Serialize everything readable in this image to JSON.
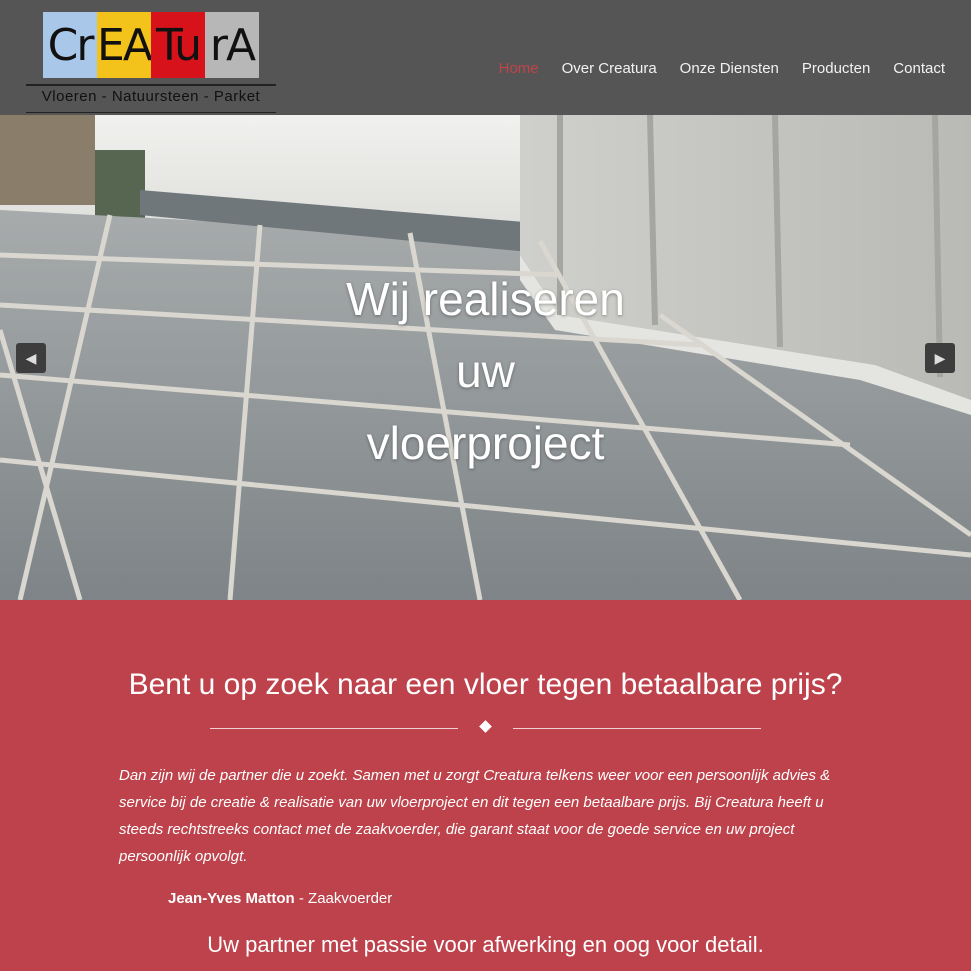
{
  "brand": {
    "logo_letters": [
      "Cr",
      "EA",
      "Tu",
      "rA"
    ],
    "logo_colors": [
      "#a9c7e8",
      "#f3c21b",
      "#d8121b",
      "#b7b7b7"
    ],
    "tagline": "Vloeren - Natuursteen - Parket"
  },
  "nav": {
    "items": [
      {
        "label": "Home",
        "active": true
      },
      {
        "label": "Over Creatura",
        "active": false
      },
      {
        "label": "Onze Diensten",
        "active": false
      },
      {
        "label": "Producten",
        "active": false
      },
      {
        "label": "Contact",
        "active": false
      }
    ],
    "active_color": "#c0444c"
  },
  "hero": {
    "title_lines": [
      "Wij realiseren",
      "uw",
      "vloerproject"
    ],
    "prev_icon": "chevron-left-icon",
    "next_icon": "chevron-right-icon"
  },
  "intro": {
    "heading": "Bent u op zoek naar een vloer tegen betaalbare prijs?",
    "body": "Dan zijn wij de partner die u zoekt. Samen met u zorgt Creatura telkens weer voor een persoonlijk advies & service bij de creatie & realisatie van uw vloerproject en dit tegen een betaalbare prijs. Bij Creatura heeft u steeds rechtstreeks contact met de zaakvoerder, die garant staat voor de goede service en uw project persoonlijk opvolgt.",
    "signature_name": "Jean-Yves Matton",
    "signature_role": " - Zaakvoerder",
    "slogan": "Uw partner met passie voor afwerking en oog voor detail.",
    "background": "#bd424b"
  }
}
